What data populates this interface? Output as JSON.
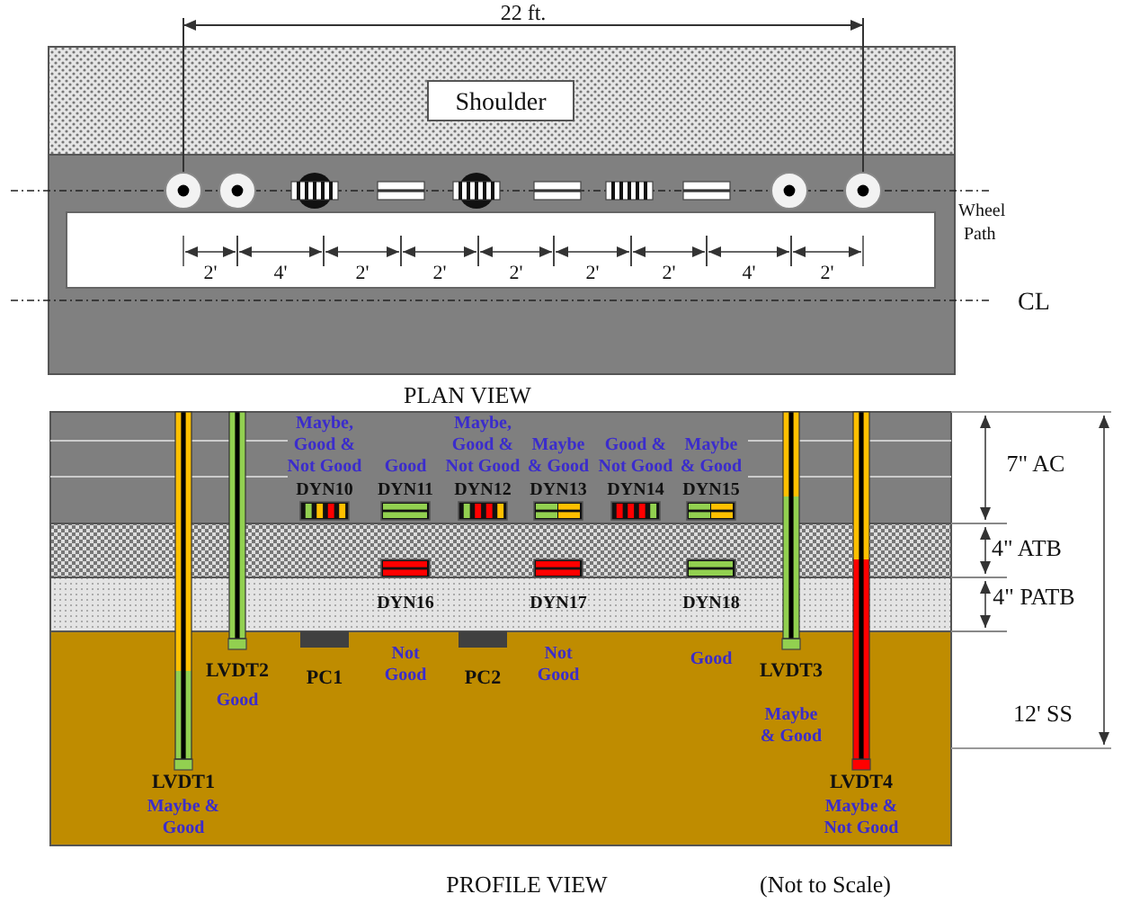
{
  "plan_view": {
    "dimension": "22 ft.",
    "shoulder_label": "Shoulder",
    "wheel_path_label": "Wheel Path",
    "centerline_label": "CL",
    "sensors": [
      {
        "kind": "lvdt"
      },
      {
        "kind": "lvdt"
      },
      {
        "kind": "round_gauge"
      },
      {
        "kind": "line_gauge"
      },
      {
        "kind": "round_gauge"
      },
      {
        "kind": "line_gauge"
      },
      {
        "kind": "bar_gauge"
      },
      {
        "kind": "line_gauge"
      },
      {
        "kind": "lvdt"
      },
      {
        "kind": "lvdt"
      }
    ],
    "spacings": [
      "2'",
      "4'",
      "2'",
      "2'",
      "2'",
      "2'",
      "2'",
      "4'",
      "2'"
    ],
    "title": "PLAN VIEW"
  },
  "profile_view": {
    "layers": [
      {
        "kind": "ac",
        "label": "7\" AC"
      },
      {
        "kind": "atb",
        "label": "4\" ATB"
      },
      {
        "kind": "patb",
        "label": "4\" PATB"
      },
      {
        "kind": "ss",
        "label": "12' SS"
      }
    ],
    "ac_gauges": [
      {
        "label": "DYN10",
        "status": [
          "Maybe,",
          "Good &",
          "Not Good"
        ],
        "kind": "vertical",
        "segments": [
          {
            "color": "#92d050"
          },
          {
            "color": "#ffc000"
          },
          {
            "color": "#ff0000"
          },
          {
            "color": "#ffc000"
          }
        ]
      },
      {
        "label": "DYN11",
        "status": [
          "Good"
        ],
        "kind": "horizontal",
        "segments": [
          {
            "color": "#92d050"
          }
        ]
      },
      {
        "label": "DYN12",
        "status": [
          "Maybe,",
          "Good &",
          "Not Good"
        ],
        "kind": "vertical",
        "segments": [
          {
            "color": "#92d050"
          },
          {
            "color": "#ff0000"
          },
          {
            "color": "#ff0000"
          },
          {
            "color": "#ffc000"
          }
        ]
      },
      {
        "label": "DYN13",
        "status": [
          "Maybe",
          "& Good"
        ],
        "kind": "horizontal",
        "segments": [
          {
            "color": "#92d050"
          },
          {
            "color": "#ffc000"
          }
        ]
      },
      {
        "label": "DYN14",
        "status": [
          "Good &",
          "Not Good"
        ],
        "kind": "vertical",
        "segments": [
          {
            "color": "#ff0000"
          },
          {
            "color": "#ff0000"
          },
          {
            "color": "#ff0000"
          },
          {
            "color": "#92d050"
          }
        ]
      },
      {
        "label": "DYN15",
        "status": [
          "Maybe",
          "& Good"
        ],
        "kind": "horizontal",
        "segments": [
          {
            "color": "#92d050"
          },
          {
            "color": "#ffc000"
          }
        ]
      }
    ],
    "atb_gauges": [
      {
        "label": "DYN16",
        "status": [
          "Not",
          "Good"
        ],
        "kind": "horizontal",
        "segments": [
          {
            "color": "#ff0000"
          }
        ]
      },
      {
        "label": "DYN17",
        "status": [
          "Not",
          "Good"
        ],
        "kind": "horizontal",
        "segments": [
          {
            "color": "#ff0000"
          }
        ]
      },
      {
        "label": "DYN18",
        "status": [
          "Good"
        ],
        "kind": "horizontal",
        "segments": [
          {
            "color": "#92d050"
          }
        ]
      }
    ],
    "lvdts": [
      {
        "label": "LVDT1",
        "status": [
          "Maybe &",
          "Good"
        ],
        "segments": [
          {
            "color": "#ffc000"
          },
          {
            "color": "#92d050"
          }
        ]
      },
      {
        "label": "LVDT2",
        "status": [
          "Good"
        ],
        "segments": [
          {
            "color": "#92d050"
          }
        ]
      },
      {
        "label": "LVDT3",
        "status": [
          "Maybe",
          "& Good"
        ],
        "segments": [
          {
            "color": "#ffc000"
          },
          {
            "color": "#92d050"
          }
        ]
      },
      {
        "label": "LVDT4",
        "status": [
          "Maybe &",
          "Not Good"
        ],
        "segments": [
          {
            "color": "#ffc000"
          },
          {
            "color": "#ff0000"
          }
        ]
      }
    ],
    "pressure_cells": [
      {
        "label": "PC1"
      },
      {
        "label": "PC2"
      }
    ],
    "title": "PROFILE VIEW",
    "note": "(Not to Scale)"
  }
}
